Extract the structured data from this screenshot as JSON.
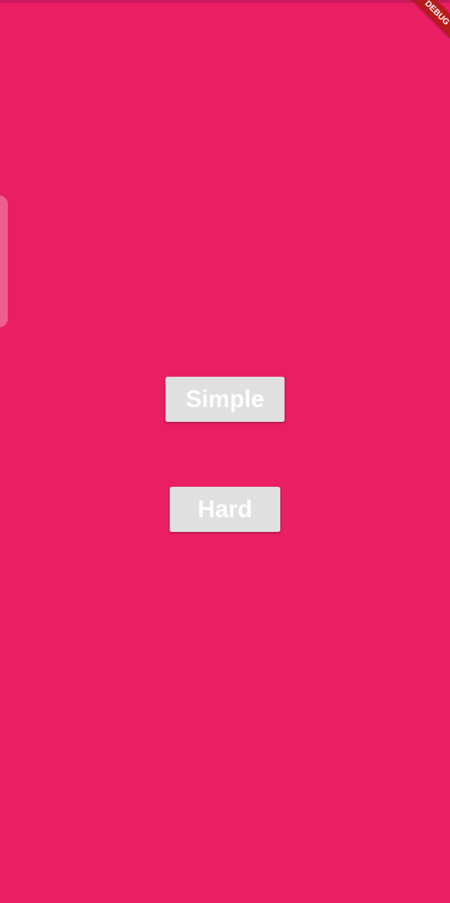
{
  "app": {
    "background_color": "#E91E63",
    "debug_banner_label": "DEBUG",
    "debug_banner_color": "#B71C1C",
    "edge_handle_color": "#F06292"
  },
  "menu": {
    "simple_label": "Simple",
    "hard_label": "Hard",
    "button_color": "#E0E0E0",
    "button_text_color": "#FFFFFF"
  }
}
